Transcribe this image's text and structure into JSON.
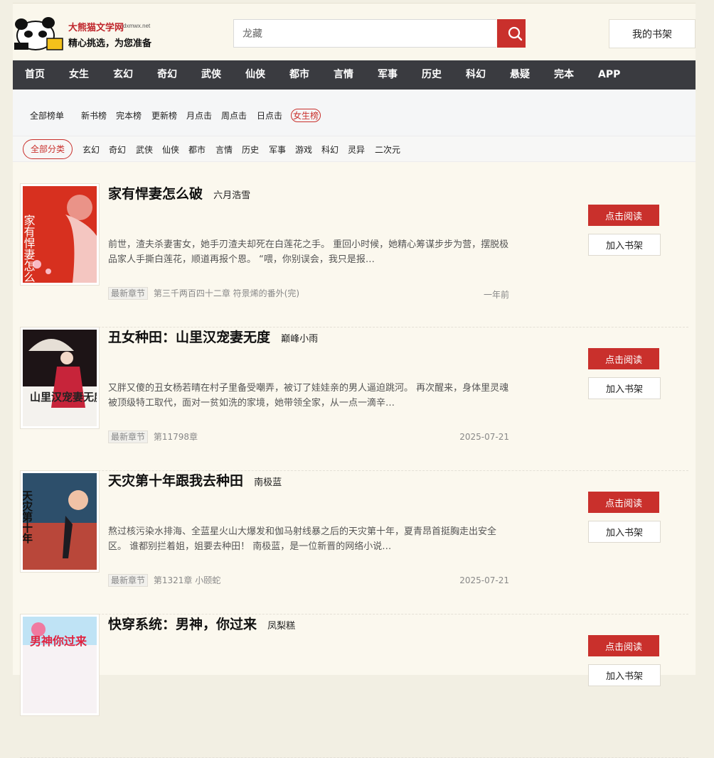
{
  "header": {
    "logo_title": "大熊猫文学网",
    "logo_domain": "dxmwx.net",
    "logo_slogan": "精心挑选，为您准备",
    "search_value": "龙藏",
    "shelf_label": "我的书架"
  },
  "nav": [
    "首页",
    "女生",
    "玄幻",
    "奇幻",
    "武侠",
    "仙侠",
    "都市",
    "言情",
    "军事",
    "历史",
    "科幻",
    "悬疑",
    "完本",
    "APP"
  ],
  "rank_tabs": {
    "all": "全部榜单",
    "items": [
      "新书榜",
      "完本榜",
      "更新榜",
      "月点击",
      "周点击",
      "日点击",
      "女生榜"
    ],
    "active": "女生榜"
  },
  "categories": {
    "all": "全部分类",
    "items": [
      "玄幻",
      "奇幻",
      "武侠",
      "仙侠",
      "都市",
      "言情",
      "历史",
      "军事",
      "游戏",
      "科幻",
      "灵异",
      "二次元"
    ]
  },
  "labels": {
    "latest_tag": "最新章节",
    "read": "点击阅读",
    "add_shelf": "加入书架"
  },
  "books": [
    {
      "title": "家有悍妻怎么破",
      "author": "六月浩雪",
      "desc": "前世，渣夫杀妻害女，她手刃渣夫却死在白莲花之手。 重回小时候，她精心筹谋步步为营，摆脱极品家人手撕白莲花，顺道再报个恩。 “喂，你别误会，我只是报…",
      "latest": "第三千两百四十二章 符景烯的番外(完)",
      "date": "一年前",
      "cover_text": "家有悍妻怎么破"
    },
    {
      "title": "丑女种田：山里汉宠妻无度",
      "author": "巅峰小雨",
      "desc": "又胖又傻的丑女杨若晴在村子里备受嘲弄，被订了娃娃亲的男人逼迫跳河。 再次醒来，身体里灵魂被顶级特工取代，面对一贫如洗的家境，她带领全家，从一点一滴辛…",
      "latest": "第11798章",
      "date": "2025-07-21",
      "cover_text": "山里汉宠妻无度"
    },
    {
      "title": "天灾第十年跟我去种田",
      "author": "南极蓝",
      "desc": "熬过核污染水排海、全蓝星火山大爆发和伽马射线暴之后的天灾第十年，夏青昂首挺胸走出安全区。 谁都别拦着姐，姐要去种田！ 南极蓝，是一位新晋的网络小说…",
      "latest": "第1321章 小颐蛇",
      "date": "2025-07-21",
      "cover_text": "天灾第十年"
    },
    {
      "title": "快穿系统：男神，你过来",
      "author": "凤梨糕",
      "desc": "",
      "latest": "",
      "date": "",
      "cover_text": "男神你过来"
    }
  ],
  "colors": {
    "accent": "#c9302c",
    "nav_bg": "#3a3b40",
    "page_bg": "#fbf8ee"
  }
}
